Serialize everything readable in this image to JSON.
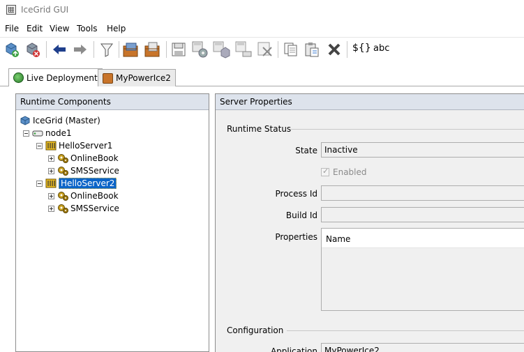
{
  "window": {
    "title": "IceGrid GUI"
  },
  "menu": [
    "File",
    "Edit",
    "View",
    "Tools",
    "Help"
  ],
  "toolbar": {
    "icons": [
      "connect-icon",
      "disconnect-icon",
      "back-arrow-icon",
      "forward-arrow-icon",
      "filter-icon",
      "open-application-icon",
      "open-application-from-file-icon",
      "save-icon",
      "save-to-registry-icon",
      "save-to-registry-no-restart-icon",
      "save-to-file-icon",
      "discard-changes-icon",
      "copy-icon",
      "paste-icon",
      "delete-icon"
    ],
    "text_buttons": [
      "${}",
      "abc"
    ]
  },
  "tabs": [
    {
      "label": "Live Deployment",
      "active": true
    },
    {
      "label": "MyPowerIce2",
      "active": false
    }
  ],
  "left_panel": {
    "header": "Runtime Components",
    "tree": {
      "root": "IceGrid (Master)",
      "node": "node1",
      "servers": [
        {
          "label": "HelloServer1",
          "selected": false,
          "children": [
            "OnlineBook",
            "SMSService"
          ]
        },
        {
          "label": "HelloServer2",
          "selected": true,
          "children": [
            "OnlineBook",
            "SMSService"
          ]
        }
      ]
    }
  },
  "right_panel": {
    "header": "Server Properties",
    "runtime_status": {
      "section_title": "Runtime Status",
      "state_label": "State",
      "state_value": "Inactive",
      "enabled_label": "Enabled",
      "enabled_checked": true,
      "process_id_label": "Process Id",
      "process_id_value": "",
      "build_id_label": "Build Id",
      "build_id_value": "",
      "properties_label": "Properties",
      "properties_column": "Name"
    },
    "configuration": {
      "section_title": "Configuration",
      "application_label": "Application",
      "application_value": "MyPowerIce2"
    }
  }
}
